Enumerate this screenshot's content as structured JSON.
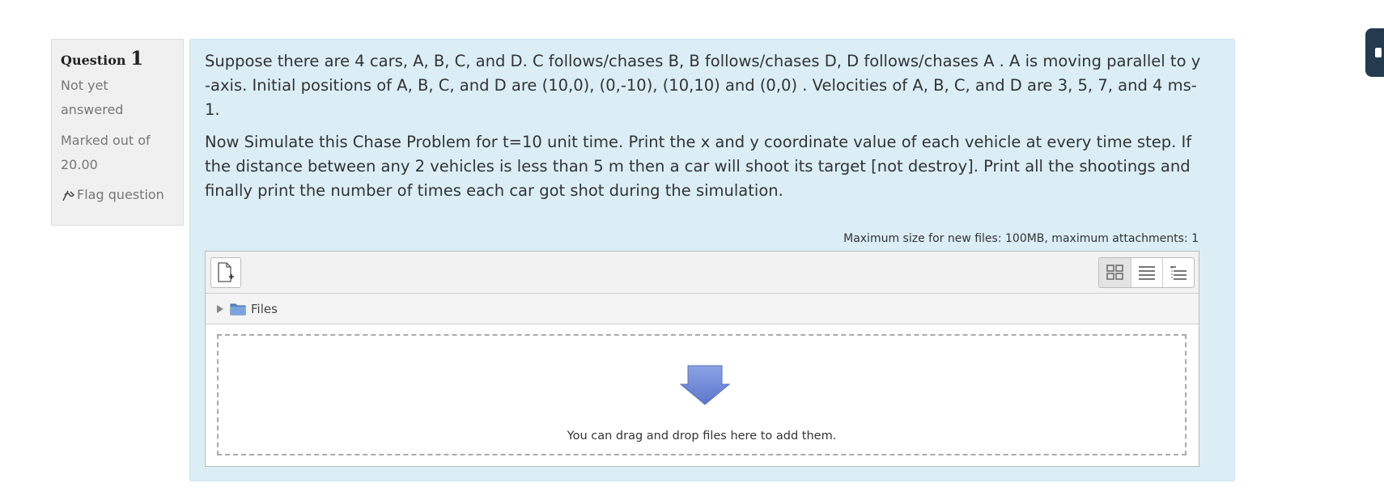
{
  "question_info": {
    "label": "Question",
    "number": "1",
    "state": "Not yet answered",
    "grade": "Marked out of 20.00",
    "flag_label": "Flag question"
  },
  "question": {
    "paragraph1": "Suppose there are 4 cars, A, B, C, and D. C follows/chases B, B follows/chases D, D follows/chases A . A is moving parallel to y -axis. Initial positions of A, B, C, and D are (10,0), (0,-10), (10,10) and (0,0)  . Velocities of A, B, C, and D are 3, 5, 7, and 4 ms-1.",
    "paragraph2": "Now Simulate this Chase Problem for t=10 unit time. Print the x and y coordinate value of each vehicle at every time step. If the distance between any 2 vehicles is less than 5 m then a car will shoot its target [not destroy]. Print all the shootings and finally print the number of times each car got shot during the simulation."
  },
  "filemanager": {
    "max_size_text": "Maximum size for new files: 100MB, maximum attachments: 1",
    "path_label": "Files",
    "drop_text": "You can drag and drop files here to add them.",
    "icons": [
      "add-file-icon",
      "icon-view-icon",
      "list-view-icon",
      "tree-view-icon",
      "folder-icon",
      "drop-arrow-icon",
      "flag-icon"
    ]
  },
  "colors": {
    "content_bg": "#dbeef6",
    "info_bg": "#f0f0f0",
    "arrow": "#6f88d6",
    "side_tab": "#243a4e"
  }
}
